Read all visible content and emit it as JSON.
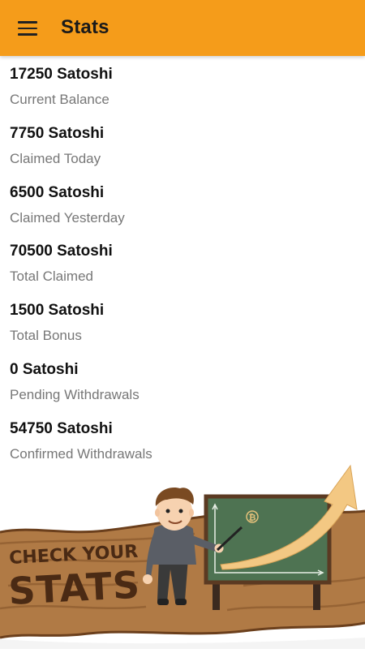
{
  "appbar": {
    "title": "Stats",
    "menu_icon": "hamburger-menu-icon",
    "color": "#F59C1A"
  },
  "stats": [
    {
      "value": "17250 Satoshi",
      "label": "Current Balance"
    },
    {
      "value": "7750 Satoshi",
      "label": "Claimed Today"
    },
    {
      "value": "6500 Satoshi",
      "label": "Claimed Yesterday"
    },
    {
      "value": "70500 Satoshi",
      "label": "Total Claimed"
    },
    {
      "value": "1500 Satoshi",
      "label": "Total Bonus"
    },
    {
      "value": "0 Satoshi",
      "label": "Pending Withdrawals"
    },
    {
      "value": "54750 Satoshi",
      "label": "Confirmed Withdrawals"
    }
  ],
  "banner": {
    "line1": "CHECK YOUR",
    "line2": "STATS",
    "board_icon": "bitcoin-icon"
  }
}
